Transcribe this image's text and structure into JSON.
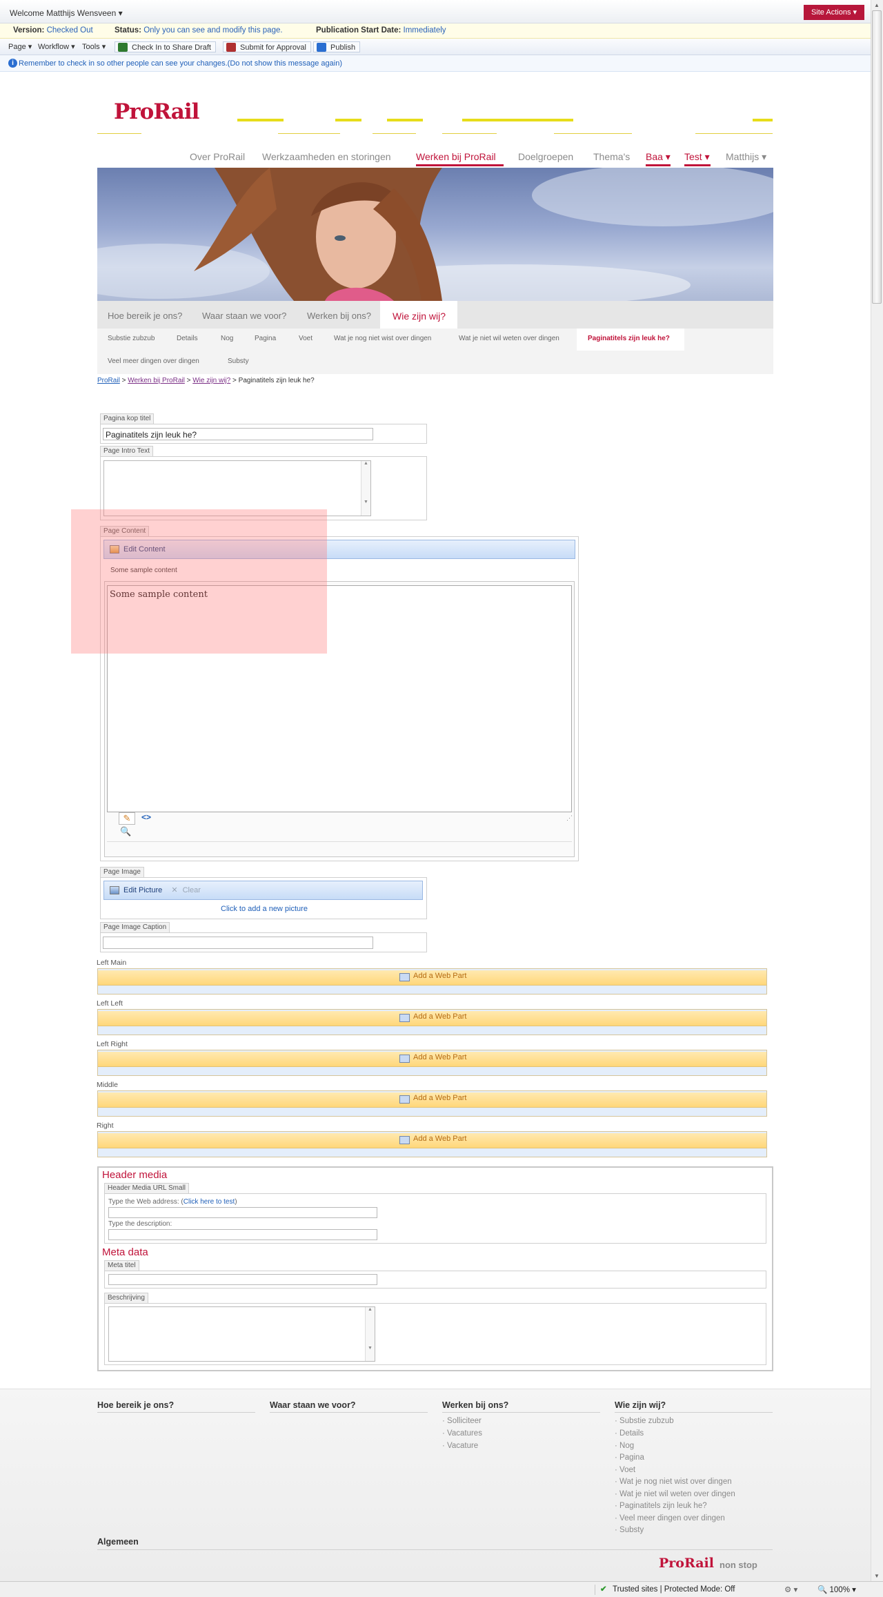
{
  "ribbon": {
    "welcome": "Welcome Matthijs Wensveen ▾",
    "site_actions": "Site Actions ▾",
    "version_label": "Version:",
    "version_value": "Checked Out",
    "status_label": "Status:",
    "status_value": "Only you can see and modify this page.",
    "pubdate_label": "Publication Start Date:",
    "pubdate_value": "Immediately",
    "menus": [
      "Page ▾",
      "Workflow ▾",
      "Tools ▾"
    ],
    "buttons": [
      "Check In to Share Draft",
      "Submit for Approval",
      "Publish"
    ],
    "message": "Remember to check in so other people can see your changes.",
    "message_link": "(Do not show this message again)"
  },
  "brand": {
    "logo": "ProRail",
    "footer_logo": "ProRail",
    "footer_tagline": "non stop",
    "accent": "#c0133a",
    "yellow": "#e7dd1a"
  },
  "top_nav": [
    "Over ProRail",
    "Werkzaamheden en storingen",
    "Werken bij ProRail",
    "Doelgroepen",
    "Thema's",
    "Baa ▾",
    "Test ▾",
    "Matthijs ▾"
  ],
  "sub_nav": [
    "Hoe bereik je ons?",
    "Waar staan we voor?",
    "Werken bij ons?",
    "Wie zijn wij?"
  ],
  "subsub_nav": [
    "Substie zubzub",
    "Details",
    "Nog",
    "Pagina",
    "Voet",
    "Wat je nog niet wist over dingen",
    "Wat je niet wil weten over dingen",
    "Paginatitels zijn leuk he?",
    "Veel meer dingen over dingen",
    "Substy"
  ],
  "breadcrumb": {
    "items": [
      "ProRail",
      "Werken bij ProRail",
      "Wie zijn wij?"
    ],
    "current": "Paginatitels zijn leuk he?",
    "sep": ">"
  },
  "fields": {
    "kop_label": "Pagina kop titel",
    "kop_value": "Paginatitels zijn leuk he?",
    "intro_label": "Page Intro Text",
    "content_label": "Page Content",
    "edit_content": "Edit Content",
    "content_preview": "Some sample content",
    "content_editor": "Some sample content",
    "image_label": "Page Image",
    "edit_picture": "Edit Picture",
    "clear": "Clear",
    "add_picture": "Click to add a new picture",
    "caption_label": "Page Image Caption"
  },
  "zones": [
    {
      "label": "Left Main",
      "button": "Add a Web Part"
    },
    {
      "label": "Left Left",
      "button": "Add a Web Part"
    },
    {
      "label": "Left Right",
      "button": "Add a Web Part"
    },
    {
      "label": "Middle",
      "button": "Add a Web Part"
    },
    {
      "label": "Right",
      "button": "Add a Web Part"
    }
  ],
  "header_media": {
    "title": "Header media",
    "field_label": "Header Media URL Small",
    "web_address": "Type the Web address: (",
    "web_link": "Click here to test",
    "web_close": ")",
    "description": "Type the description:"
  },
  "meta": {
    "title": "Meta data",
    "titel_label": "Meta titel",
    "beschrijving_label": "Beschrijving"
  },
  "footer": {
    "columns": [
      {
        "head": "Hoe bereik je ons?",
        "links": []
      },
      {
        "head": "Waar staan we voor?",
        "links": []
      },
      {
        "head": "Werken bij ons?",
        "links": [
          "Solliciteer",
          "Vacatures",
          "Vacature"
        ]
      },
      {
        "head": "Wie zijn wij?",
        "links": [
          "Substie zubzub",
          "Details",
          "Nog",
          "Pagina",
          "Voet",
          "Wat je nog niet wist over dingen",
          "Wat je niet wil weten over dingen",
          "Paginatitels zijn leuk he?",
          "Veel meer dingen over dingen",
          "Substy"
        ]
      }
    ],
    "algemeen": "Algemeen"
  },
  "ie_status": {
    "zone": "Trusted sites | Protected Mode: Off",
    "zoom": "100%"
  }
}
